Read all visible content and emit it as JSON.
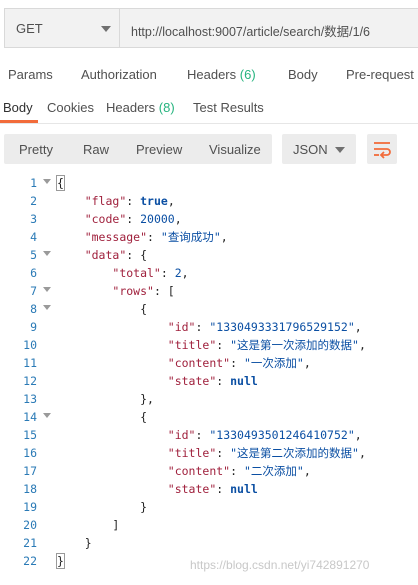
{
  "request": {
    "method": "GET",
    "url": "http://localhost:9007/article/search/数据/1/6"
  },
  "request_tabs": [
    {
      "label": "Params",
      "count": ""
    },
    {
      "label": "Authorization",
      "count": ""
    },
    {
      "label": "Headers",
      "count": "(6)"
    },
    {
      "label": "Body",
      "count": ""
    },
    {
      "label": "Pre-request S",
      "count": ""
    }
  ],
  "response_tabs": [
    {
      "label": "Body",
      "count": ""
    },
    {
      "label": "Cookies",
      "count": ""
    },
    {
      "label": "Headers",
      "count": "(8)"
    },
    {
      "label": "Test Results",
      "count": ""
    }
  ],
  "view_modes": [
    "Pretty",
    "Raw",
    "Preview",
    "Visualize"
  ],
  "format": "JSON",
  "colors": {
    "accent": "#f26b3a",
    "count": "#26b47f",
    "line_number": "#2a7ab6",
    "key": "#a0213d",
    "value": "#0b4fa3"
  },
  "response_body": {
    "flag": "true",
    "code": "20000",
    "message": "查询成功",
    "data": {
      "total": "2",
      "rows": [
        {
          "id": "1330493331796529152",
          "title": "这是第一次添加的数据",
          "content": "一次添加",
          "state": "null"
        },
        {
          "id": "1330493501246410752",
          "title": "这是第二次添加的数据",
          "content": "二次添加",
          "state": "null"
        }
      ]
    }
  },
  "line_numbers": [
    "1",
    "2",
    "3",
    "4",
    "5",
    "6",
    "7",
    "8",
    "9",
    "10",
    "11",
    "12",
    "13",
    "14",
    "15",
    "16",
    "17",
    "18",
    "19",
    "20",
    "21",
    "22"
  ],
  "watermark": "https://blog.csdn.net/yi742891270"
}
